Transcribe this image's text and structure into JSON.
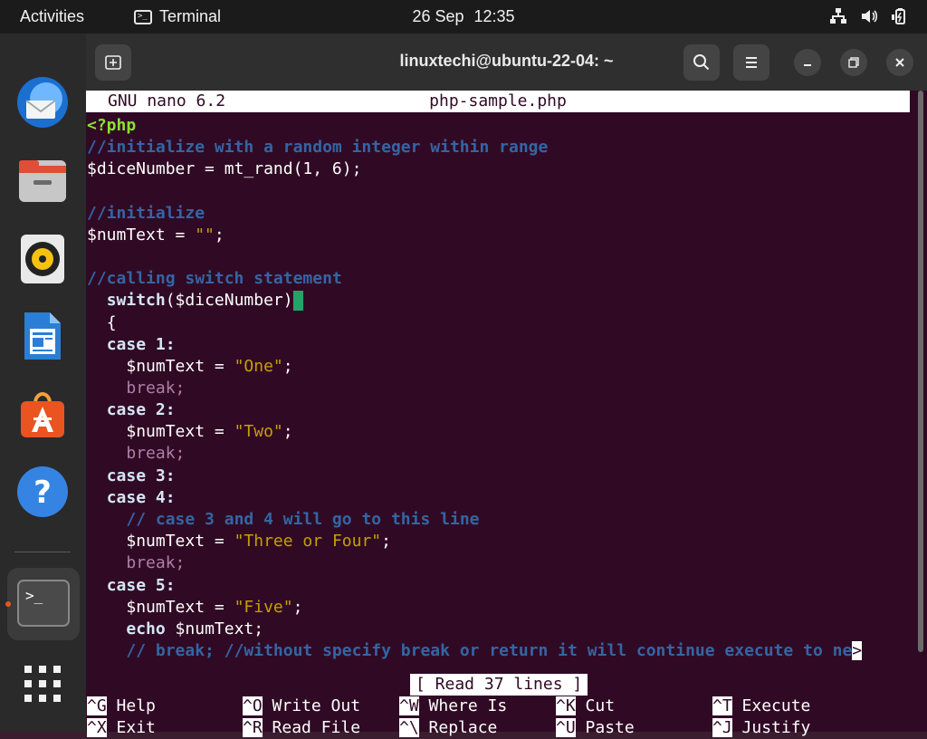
{
  "topbar": {
    "activities": "Activities",
    "app_name": "Terminal",
    "date": "26 Sep",
    "time": "12:35"
  },
  "window": {
    "title": "linuxtechi@ubuntu-22-04: ~"
  },
  "nano": {
    "version": "GNU nano 6.2",
    "filename": "php-sample.php",
    "status": "[ Read 37 lines ]"
  },
  "code": {
    "l1": "<?php",
    "l2": "//initialize with a random integer within range",
    "l3a": "$diceNumber",
    "l3b": " = mt_rand(1, 6);",
    "l5": "//initialize",
    "l6a": "$numText",
    "l6b": " = ",
    "l6c": "\"\"",
    "l6d": ";",
    "l8": "//calling switch statement",
    "l9a": "switch",
    "l9b": "($diceNumber)",
    "l10": "{",
    "l11": "case 1:",
    "l12a": "$numText",
    "l12b": " = ",
    "l12c": "\"One\"",
    "l12d": ";",
    "l13": "break;",
    "l14": "case 2:",
    "l15a": "$numText",
    "l15b": " = ",
    "l15c": "\"Two\"",
    "l15d": ";",
    "l16": "break;",
    "l17": "case 3:",
    "l18": "case 4:",
    "l19": "// case 3 and 4 will go to this line",
    "l20a": "$numText",
    "l20b": " = ",
    "l20c": "\"Three or Four\"",
    "l20d": ";",
    "l21": "break;",
    "l22": "case 5:",
    "l23a": "$numText",
    "l23b": " = ",
    "l23c": "\"Five\"",
    "l23d": ";",
    "l24a": "echo",
    "l24b": " $numText;",
    "l25": "// break; //without specify break or return it will continue execute to ne",
    "l25more": ">"
  },
  "shortcuts": [
    {
      "key": "^G",
      "label": "Help"
    },
    {
      "key": "^O",
      "label": "Write Out"
    },
    {
      "key": "^W",
      "label": "Where Is"
    },
    {
      "key": "^K",
      "label": "Cut"
    },
    {
      "key": "^T",
      "label": "Execute"
    },
    {
      "key": "^X",
      "label": "Exit"
    },
    {
      "key": "^R",
      "label": "Read File"
    },
    {
      "key": "^\\",
      "label": "Replace"
    },
    {
      "key": "^U",
      "label": "Paste"
    },
    {
      "key": "^J",
      "label": "Justify"
    }
  ],
  "colors": {
    "terminal_bg": "#300a24",
    "cursor": "#26a269",
    "comment": "#3465a4",
    "string": "#c4a000",
    "php_tag": "#8ae234",
    "break_kw": "#ad7fa8"
  },
  "dock_icons": [
    "thunderbird-icon",
    "files-icon",
    "rhythmbox-icon",
    "writer-icon",
    "software-icon",
    "help-icon",
    "terminal-icon",
    "app-grid-icon"
  ]
}
